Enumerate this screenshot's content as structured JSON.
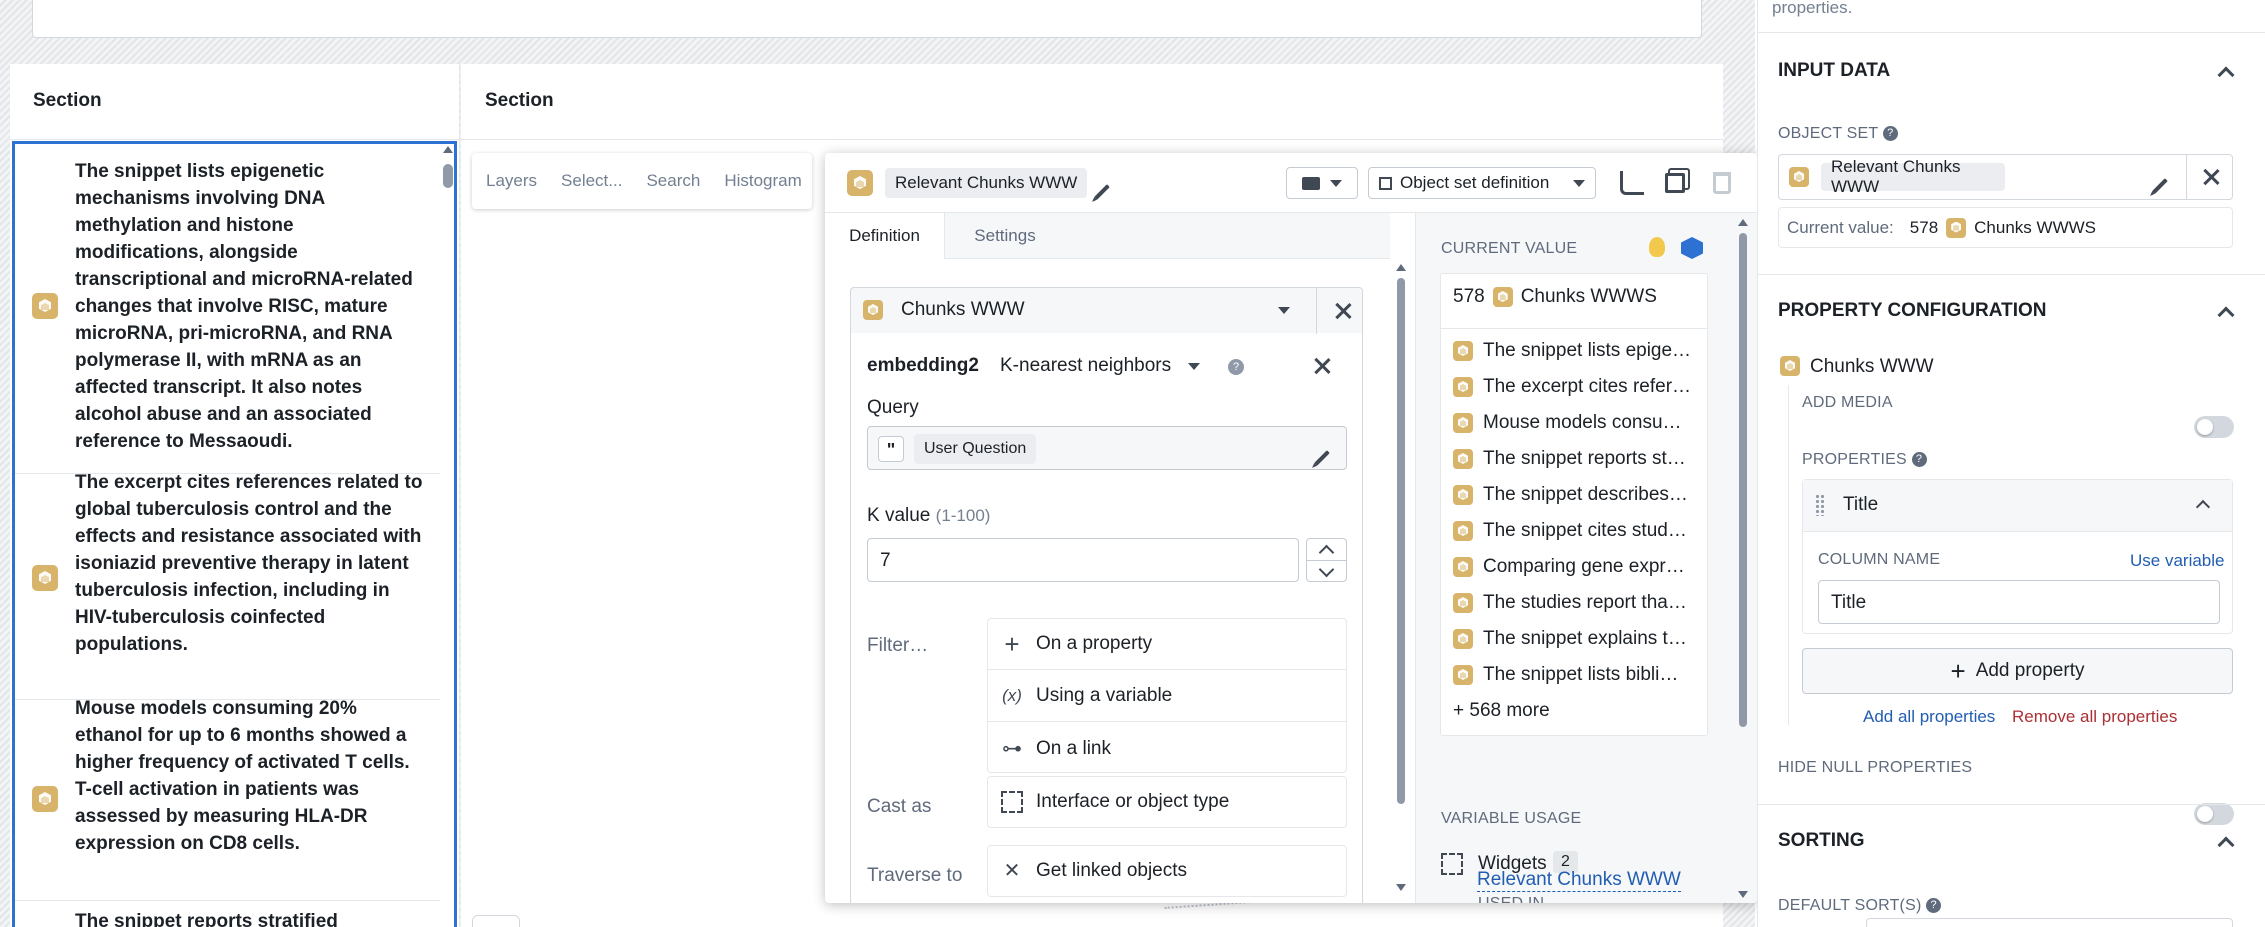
{
  "left": {
    "section1_title": "Section",
    "section2_title": "Section",
    "cards": [
      {
        "text": "The snippet lists epigenetic mechanisms involving DNA methylation and histone modifications, alongside transcriptional and microRNA-related changes that involve RISC, mature microRNA, pri-microRNA, and RNA polymerase II, with mRNA as an affected transcript. It also notes alcohol abuse and an associated reference to Messaoudi."
      },
      {
        "text": "The excerpt cites references related to global tuberculosis control and the effects and resistance associated with isoniazid preventive therapy in latent tuberculosis infection, including in HIV-tuberculosis coinfected populations."
      },
      {
        "text": "Mouse models consuming 20% ethanol for up to 6 months showed a higher frequency of activated T cells. T-cell activation in patients was assessed by measuring HLA-DR expression on CD8 cells."
      },
      {
        "text": "The snippet reports stratified"
      }
    ],
    "toolbar": [
      "Layers",
      "Select...",
      "Search",
      "Histogram"
    ]
  },
  "editor": {
    "object_set_name": "Relevant Chunks WWW",
    "definition_dropdown": "Object set definition",
    "tabs": [
      "Definition",
      "Settings"
    ],
    "base_object": "Chunks WWW",
    "filter_property": "embedding2",
    "filter_type": "K-nearest neighbors",
    "query_label": "Query",
    "query_value": "User Question",
    "k_label": "K value",
    "k_range": "(1-100)",
    "k_value": "7",
    "filter_label": "Filter…",
    "filter_options": [
      "On a property",
      "Using a variable",
      "On a link"
    ],
    "filter_icons": [
      "+",
      "(x)",
      "⊶"
    ],
    "cast_label": "Cast as",
    "cast_option": "Interface or object type",
    "traverse_label": "Traverse to",
    "traverse_option": "Get linked objects"
  },
  "current_value": {
    "heading": "CURRENT VALUE",
    "count": "578",
    "type": "Chunks WWWS",
    "rows": [
      "The snippet lists epige…",
      "The excerpt cites refer…",
      "Mouse models consu…",
      "The snippet reports st…",
      "The snippet describes…",
      "The snippet cites stud…",
      "Comparing gene expr…",
      "The studies report tha…",
      "The snippet explains t…",
      "The snippet lists bibli…"
    ],
    "more": "+ 568 more",
    "usage_heading": "VARIABLE USAGE",
    "widgets_label": "Widgets",
    "widgets_count": "2",
    "used_in_label": "USED IN",
    "used_in_link": "Relevant Chunks WWW"
  },
  "right_panel": {
    "top_text": "properties.",
    "input_data_heading": "INPUT DATA",
    "object_set_label": "OBJECT SET",
    "object_set_value": "Relevant Chunks WWW",
    "current_value_label": "Current value:",
    "current_value_count": "578",
    "current_value_type": "Chunks WWWS",
    "property_config_heading": "PROPERTY CONFIGURATION",
    "object_type": "Chunks WWW",
    "add_media_label": "ADD MEDIA",
    "properties_label": "PROPERTIES",
    "property_title": "Title",
    "column_name_label": "COLUMN NAME",
    "use_variable": "Use variable",
    "column_name_value": "Title",
    "add_property": "Add property",
    "add_all": "Add all properties",
    "remove_all": "Remove all properties",
    "hide_null_label": "HIDE NULL PROPERTIES",
    "sorting_heading": "SORTING",
    "default_sort_label": "DEFAULT SORT(S)"
  },
  "colors": {
    "accent_blue": "#215db0",
    "object_gold": "#d8b46a",
    "danger_red": "#ac2f33",
    "selection_border": "#2d72d2"
  }
}
